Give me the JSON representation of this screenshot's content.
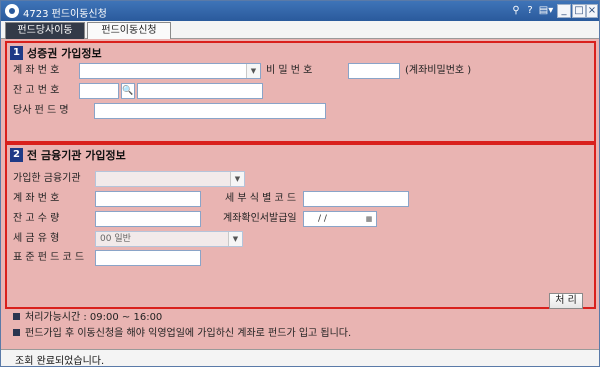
{
  "window": {
    "title": "4723 펀드이동신청",
    "controls": {
      "pin": "⚲",
      "help": "?",
      "menu": "▤▾",
      "minimize": "_",
      "maximize": "□",
      "close": "×"
    }
  },
  "tabs": [
    {
      "label": "펀드당사이동",
      "active": true
    },
    {
      "label": "펀드이동신청",
      "active": false
    }
  ],
  "section1": {
    "number": "1",
    "title": "성증권 가입정보",
    "fields": {
      "account_label": "계 좌 번 호",
      "password_label": "비 밀 번 호",
      "password_hint": "(계좌비밀번호 )",
      "balance_label": "잔 고 번 호",
      "fund_name_label": "당사 펀 드 명"
    }
  },
  "section2": {
    "number": "2",
    "title": "전 금융기관 가입정보",
    "fields": {
      "institution_label": "가입한 금융기관",
      "account_label": "계 좌 번 호",
      "detail_code_label": "세 부 식 별 코 드",
      "quantity_label": "잔 고 수 량",
      "issue_date_label": "계좌확인서발급일",
      "issue_date_value": "/ /",
      "tax_type_label": "세 금 유 형",
      "tax_type_value": "00 일반",
      "std_fund_code_label": "표 준 펀 드 코 드"
    },
    "process_button": "처 리"
  },
  "notices": [
    "처리가능시간 : 09:00 ~ 16:00",
    "펀드가입 후 이동신청을 해야 익영업일에 가입하신 계좌로 펀드가 입고 됩니다."
  ],
  "status_bar": {
    "message": "조회 완료되었습니다."
  }
}
